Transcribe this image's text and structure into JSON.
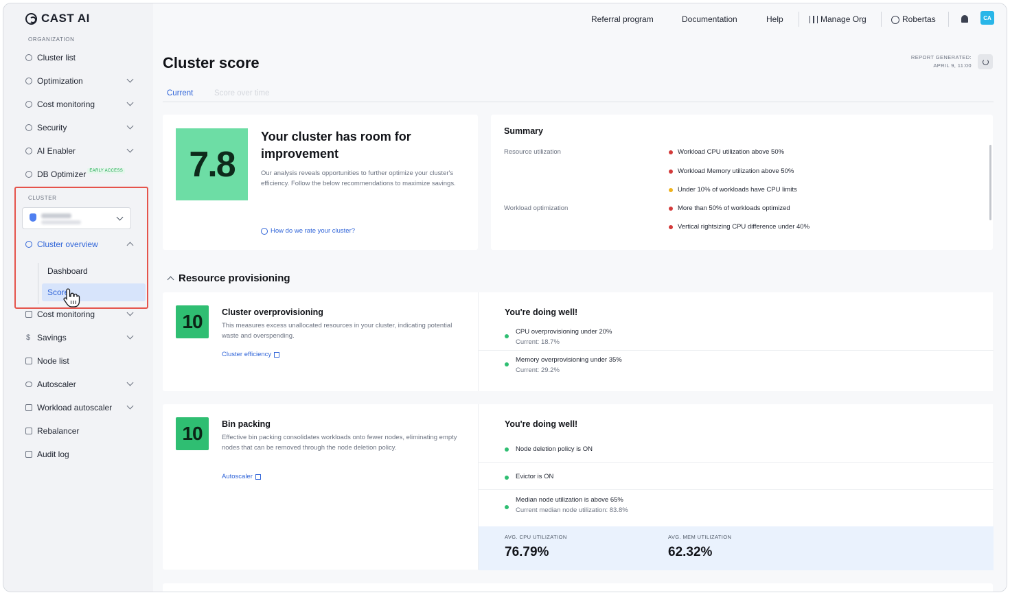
{
  "brand": {
    "name": "CAST AI"
  },
  "sidebar": {
    "org_label": "ORGANIZATION",
    "org_items": [
      {
        "label": "Cluster list",
        "icon": "circle-icon"
      },
      {
        "label": "Optimization",
        "icon": "gear-icon"
      },
      {
        "label": "Cost monitoring",
        "icon": "gear-icon"
      },
      {
        "label": "Security",
        "icon": "shield-icon"
      },
      {
        "label": "AI Enabler",
        "icon": "gear-icon"
      },
      {
        "label": "DB Optimizer",
        "icon": "database-icon",
        "badge": "EARLY ACCESS"
      }
    ],
    "cluster_label": "CLUSTER",
    "cluster_items": [
      {
        "label": "Cluster overview",
        "active": true
      },
      {
        "label": "Dashboard"
      },
      {
        "label": "Score",
        "active": true
      },
      {
        "label": "Cost monitoring"
      },
      {
        "label": "Savings"
      },
      {
        "label": "Node list"
      },
      {
        "label": "Autoscaler"
      },
      {
        "label": "Workload autoscaler"
      },
      {
        "label": "Rebalancer"
      },
      {
        "label": "Audit log"
      }
    ]
  },
  "topbar": {
    "referral": "Referral program",
    "documentation": "Documentation",
    "help": "Help",
    "manage_org": "Manage Org",
    "user": "Robertas",
    "avatar": "CA"
  },
  "page": {
    "title": "Cluster score",
    "report_label": "REPORT GENERATED:",
    "report_date": "APRIL 9, 11:00",
    "tabs": [
      {
        "label": "Current"
      },
      {
        "label": "Score over time"
      }
    ]
  },
  "overall": {
    "score": "7.8",
    "heading": "Your cluster has room for improvement",
    "description": "Our analysis reveals opportunities to further optimize your cluster's efficiency. Follow the below recommendations to maximize savings.",
    "link": "How do we rate your cluster?"
  },
  "summary": {
    "title": "Summary",
    "groups": [
      {
        "label": "Resource utilization",
        "items": [
          {
            "text": "Workload CPU utilization above 50%",
            "status": "red"
          },
          {
            "text": "Workload Memory utilization above 50%",
            "status": "red"
          },
          {
            "text": "Under 10% of workloads have CPU limits",
            "status": "yellow"
          }
        ]
      },
      {
        "label": "Workload optimization",
        "items": [
          {
            "text": "More than 50% of workloads optimized",
            "status": "red"
          },
          {
            "text": "Vertical rightsizing CPU difference under 40%",
            "status": "red"
          }
        ]
      }
    ],
    "colors": {
      "red": "#d33a3a",
      "yellow": "#efb21d",
      "green": "#2fbe72"
    }
  },
  "section": {
    "title": "Resource provisioning"
  },
  "overprovisioning": {
    "score": "10",
    "title": "Cluster overprovisioning",
    "description": "This measures excess unallocated resources in your cluster, indicating potential waste and overspending.",
    "link": "Cluster efficiency",
    "status_title": "You're doing well!",
    "checks": [
      {
        "text": "CPU overprovisioning under 20%",
        "sub": "Current: 18.7%"
      },
      {
        "text": "Memory overprovisioning under 35%",
        "sub": "Current: 29.2%"
      }
    ]
  },
  "binpacking": {
    "score": "10",
    "title": "Bin packing",
    "description": "Effective bin packing consolidates workloads onto fewer nodes, eliminating empty nodes that can be removed through the node deletion policy.",
    "link": "Autoscaler",
    "status_title": "You're doing well!",
    "checks": [
      {
        "text": "Node deletion policy is ON"
      },
      {
        "text": "Evictor is ON"
      },
      {
        "text": "Median node utilization is above 65%",
        "sub": "Current median node utilization: 83.8%"
      }
    ],
    "cpu_label": "AVG. CPU UTILIZATION",
    "cpu_value": "76.79%",
    "mem_label": "AVG. MEM UTILIZATION",
    "mem_value": "62.32%"
  }
}
